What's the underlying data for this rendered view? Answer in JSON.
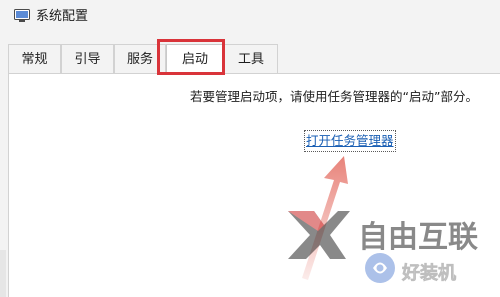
{
  "window": {
    "title": "系统配置",
    "icon": "system-config-icon"
  },
  "tabs": [
    {
      "label": "常规",
      "active": false
    },
    {
      "label": "引导",
      "active": false
    },
    {
      "label": "服务",
      "active": false
    },
    {
      "label": "启动",
      "active": true
    },
    {
      "label": "工具",
      "active": false
    }
  ],
  "startup": {
    "message": "若要管理启动项，请使用任务管理器的“启动”部分。",
    "link_label": "打开任务管理器"
  },
  "annotation": {
    "highlight_color": "#d9343a",
    "arrow_color": "#e8837a"
  },
  "watermark": {
    "brand_text": "自由互联",
    "sub_text": "好装机"
  }
}
